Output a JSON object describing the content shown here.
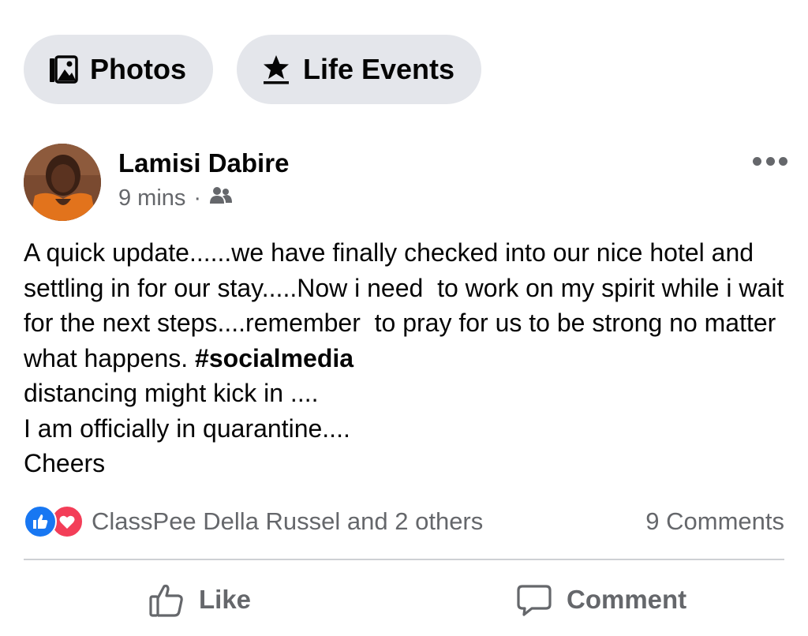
{
  "chips": {
    "photos": {
      "label": "Photos",
      "icon": "photos-icon"
    },
    "life_events": {
      "label": "Life Events",
      "icon": "star-icon"
    }
  },
  "post": {
    "author": "Lamisi Dabire",
    "time": "9 mins",
    "separator": "·",
    "audience_icon": "friends-icon",
    "text_before_hashtag": "A quick update......we have finally checked into our nice hotel and settling in for our stay.....Now i need  to work on my spirit while i wait  for the next steps....remember  to pray for us to be strong no matter what happens. ",
    "hashtag": "#socialmedia",
    "text_after_hashtag": "\ndistancing might kick in ....\nI am officially in quarantine....\nCheers"
  },
  "reactions": {
    "names": "ClassPee Della Russel and 2 others",
    "comments": "9 Comments",
    "like_color": "#1877f2",
    "love_color": "#f33e58"
  },
  "actions": {
    "like": "Like",
    "comment": "Comment"
  }
}
